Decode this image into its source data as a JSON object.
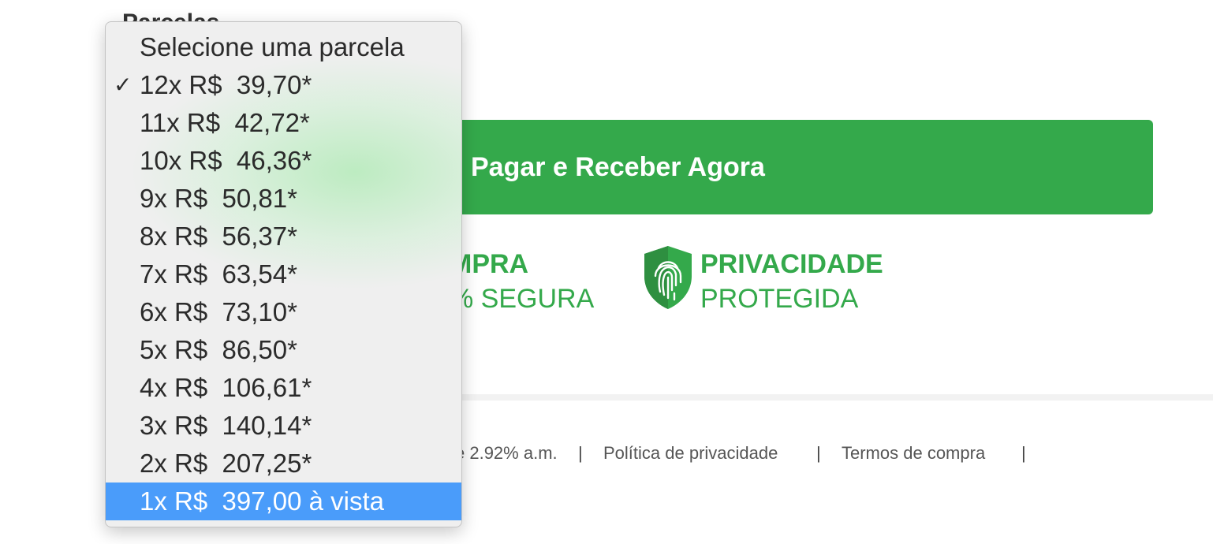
{
  "page": {
    "under_label": "Parcelas"
  },
  "actions": {
    "pay_button_label": "Pagar e Receber Agora"
  },
  "badges": [
    {
      "title": "MPRA",
      "subtitle": "% SEGURA"
    },
    {
      "title": "PRIVACIDADE",
      "subtitle": "PROTEGIDA",
      "icon": "fingerprint-shield-icon"
    }
  ],
  "footer": {
    "rate_text": "e 2.92% a.m.",
    "sep1": "|",
    "privacy_link": "Política de privacidade",
    "sep2": "|",
    "terms_link": "Termos de compra",
    "sep3": "|"
  },
  "installments_menu": {
    "checked_index": 1,
    "highlighted_index": 12,
    "check_mark": "✓",
    "options": [
      "Selecione uma parcela",
      "12x R$  39,70*",
      "11x R$  42,72*",
      "10x R$  46,36*",
      "9x R$  50,81*",
      "8x R$  56,37*",
      "7x R$  63,54*",
      "6x R$  73,10*",
      "5x R$  86,50*",
      "4x R$  106,61*",
      "3x R$  140,14*",
      "2x R$  207,25*",
      "1x R$  397,00 à vista"
    ]
  },
  "colors": {
    "brand_green": "#34a94b",
    "highlight_blue": "#4a9cfa"
  }
}
